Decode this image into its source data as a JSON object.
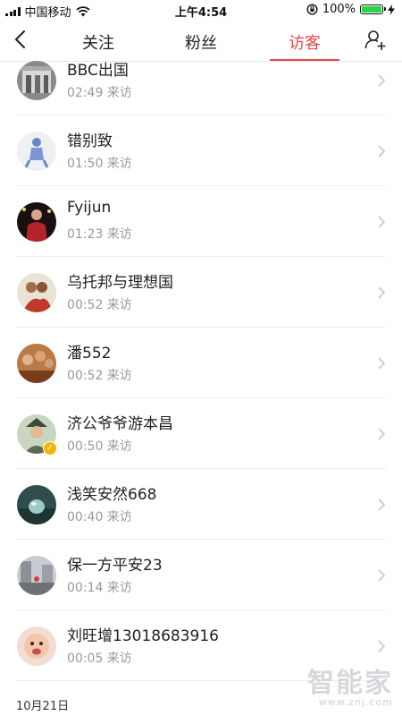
{
  "status_bar": {
    "carrier": "中国移动",
    "time": "上午4:54",
    "battery_percent": "100%",
    "battery_level": 1.0
  },
  "nav": {
    "tabs": [
      {
        "label": "关注",
        "active": false
      },
      {
        "label": "粉丝",
        "active": false
      },
      {
        "label": "访客",
        "active": true
      }
    ],
    "accent_color": "#e8484e"
  },
  "visitors": [
    {
      "name": "BBC出国",
      "time": "02:49 来访",
      "avatar": "building-photo"
    },
    {
      "name": "错别致",
      "time": "01:50 来访",
      "avatar": "dancer-photo"
    },
    {
      "name": "Fyijun",
      "time": "01:23 来访",
      "avatar": "red-figure-photo"
    },
    {
      "name": "乌托邦与理想国",
      "time": "00:52 来访",
      "avatar": "group-photo"
    },
    {
      "name": "潘552",
      "time": "00:52 来访",
      "avatar": "crowd-photo"
    },
    {
      "name": "济公爷爷游本昌",
      "time": "00:50 来访",
      "avatar": "elder-photo",
      "verified": true
    },
    {
      "name": "浅笑安然668",
      "time": "00:40 来访",
      "avatar": "water-drop-photo"
    },
    {
      "name": "保一方平安23",
      "time": "00:14 来访",
      "avatar": "street-photo"
    },
    {
      "name": "刘旺增13018683916",
      "time": "00:05 来访",
      "avatar": "baby-photo"
    }
  ],
  "date_header": "10月21日",
  "watermark": {
    "main": "智能家",
    "url": "www.znj.com"
  }
}
